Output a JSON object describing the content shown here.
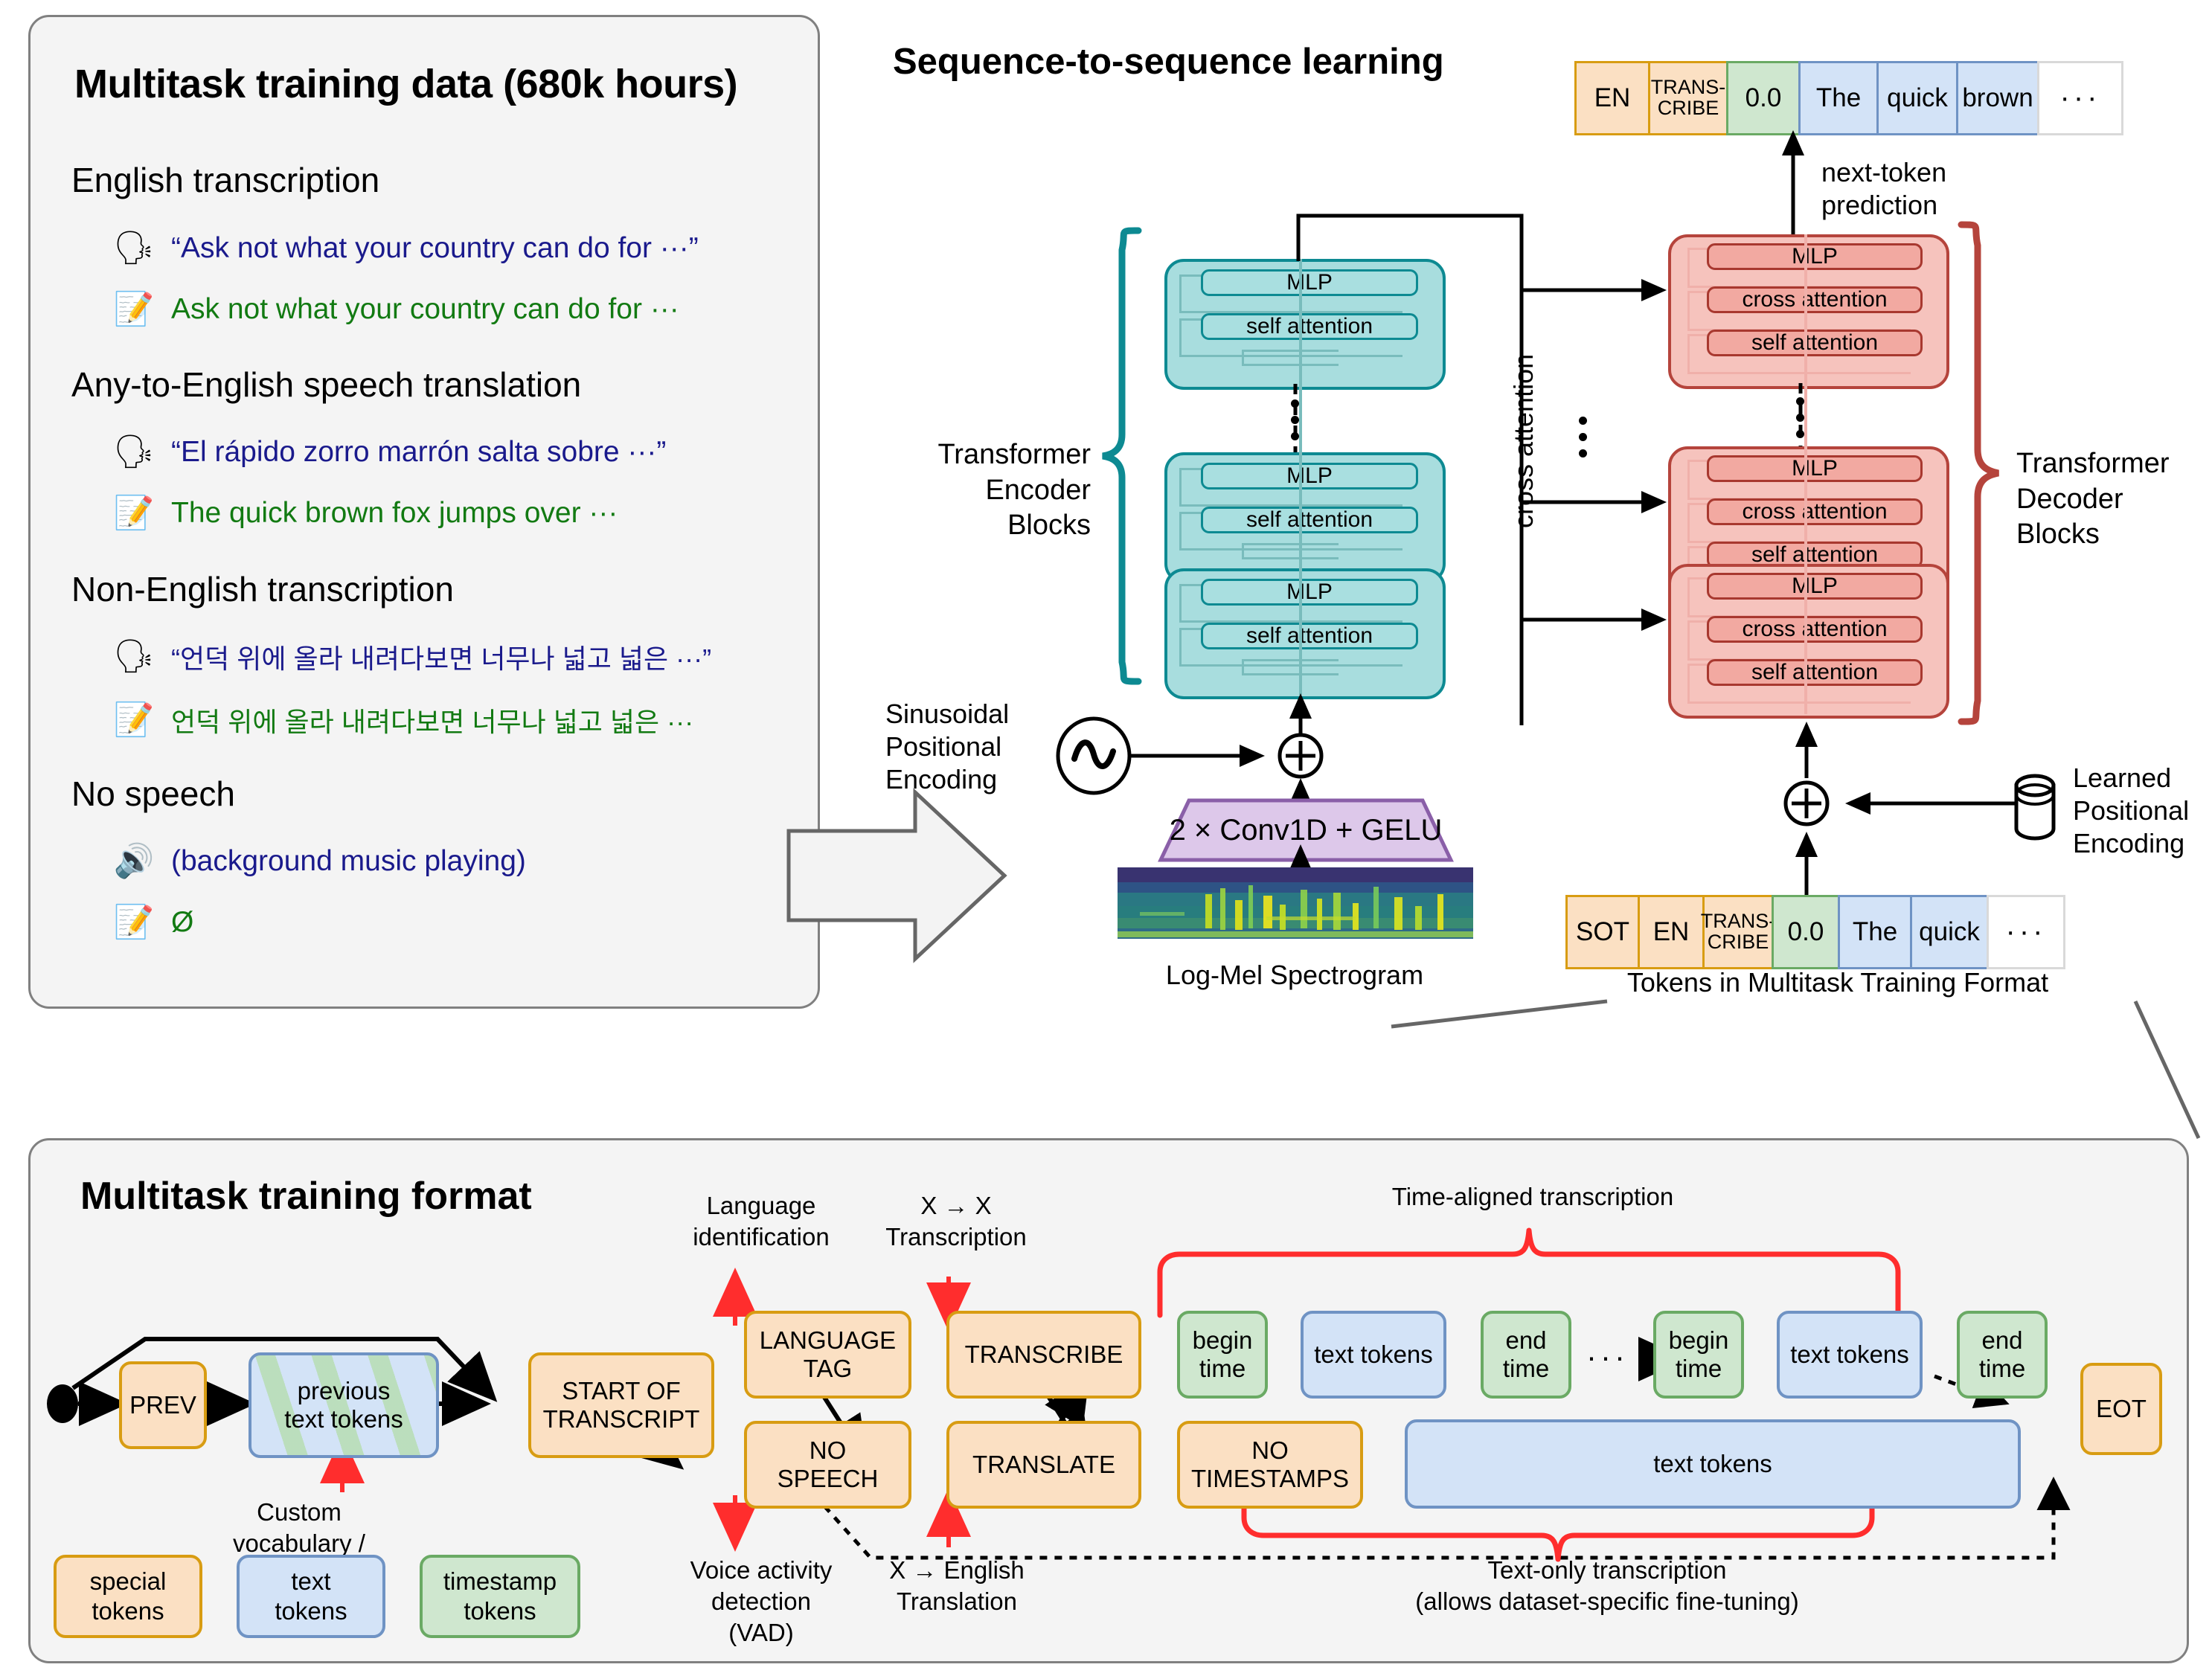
{
  "left_panel": {
    "title": "Multitask training data (680k hours)",
    "categories": [
      {
        "heading": "English transcription",
        "speech_icon": "speaking-head-icon",
        "speech": "“Ask not what your country can do for ···”",
        "text_icon": "memo-pencil-icon",
        "text": "Ask not what your country can do for ···"
      },
      {
        "heading": "Any-to-English speech translation",
        "speech_icon": "speaking-head-icon",
        "speech": "“El rápido zorro marrón salta sobre ···”",
        "text_icon": "memo-pencil-icon",
        "text": "The quick brown fox jumps over ···"
      },
      {
        "heading": "Non-English transcription",
        "speech_icon": "speaking-head-icon",
        "speech": "“언덕 위에 올라 내려다보면 너무나 넓고 넓은 ···”",
        "text_icon": "memo-pencil-icon",
        "text": "언덕 위에 올라 내려다보면 너무나 넓고 넓은 ···"
      },
      {
        "heading": "No speech",
        "speech_icon": "loud-speaker-icon",
        "speech": "(background music playing)",
        "text_icon": "memo-pencil-icon",
        "text": "Ø"
      }
    ]
  },
  "seq2seq": {
    "title": "Sequence-to-sequence learning",
    "output_tokens": [
      {
        "label": "EN",
        "kind": "special"
      },
      {
        "label": "TRANS-\nCRIBE",
        "kind": "special"
      },
      {
        "label": "0.0",
        "kind": "time"
      },
      {
        "label": "The",
        "kind": "text"
      },
      {
        "label": "quick",
        "kind": "text"
      },
      {
        "label": "brown",
        "kind": "text"
      },
      {
        "label": "···",
        "kind": "blank"
      }
    ],
    "input_tokens": [
      {
        "label": "SOT",
        "kind": "special"
      },
      {
        "label": "EN",
        "kind": "special"
      },
      {
        "label": "TRANS-\nCRIBE",
        "kind": "special"
      },
      {
        "label": "0.0",
        "kind": "time"
      },
      {
        "label": "The",
        "kind": "text"
      },
      {
        "label": "quick",
        "kind": "text"
      },
      {
        "label": "···",
        "kind": "blank"
      }
    ],
    "next_token_prediction": "next-token\nprediction",
    "cross_attention": "cross attention",
    "encoder_label": "Transformer\nEncoder Blocks",
    "decoder_label": "Transformer\nDecoder Blocks",
    "encoder_sublayers": [
      "MLP",
      "self attention"
    ],
    "decoder_sublayers": [
      "MLP",
      "cross attention",
      "self attention"
    ],
    "sinusoidal_pe": "Sinusoidal\nPositional\nEncoding",
    "learned_pe": "Learned\nPositional\nEncoding",
    "conv_block": "2 × Conv1D + GELU",
    "spectrogram_caption": "Log-Mel Spectrogram",
    "tokens_caption": "Tokens in Multitask Training Format",
    "sine_icon": "sine-wave-icon",
    "database_icon": "database-cylinder-icon",
    "plus_icon": "circled-plus-icon"
  },
  "bottom_panel": {
    "title": "Multitask training format",
    "nodes": {
      "prev": "PREV",
      "previous_text_tokens": "previous\ntext tokens",
      "start_of_transcript": "START OF\nTRANSCRIPT",
      "language_tag": "LANGUAGE\nTAG",
      "no_speech": "NO\nSPEECH",
      "transcribe": "TRANSCRIBE",
      "translate": "TRANSLATE",
      "no_timestamps": "NO\nTIMESTAMPS",
      "begin_time_1": "begin\ntime",
      "text_tokens_1": "text tokens",
      "end_time_1": "end\ntime",
      "ellipsis": "···",
      "begin_time_2": "begin\ntime",
      "text_tokens_2": "text tokens",
      "end_time_2": "end\ntime",
      "text_tokens_long": "text tokens",
      "eot": "EOT"
    },
    "annotations": {
      "custom_vocabulary": "Custom vocabulary /\nprompting",
      "language_identification": "Language\nidentification",
      "x_to_x_transcription": "X → X\nTranscription",
      "voice_activity_detection": "Voice activity\ndetection\n(VAD)",
      "x_to_english_translation": "X → English\nTranslation",
      "time_aligned_transcription": "Time-aligned transcription",
      "text_only_transcription": "Text-only transcription\n(allows dataset-specific fine-tuning)"
    },
    "legend": [
      {
        "label": "special\ntokens",
        "kind": "special"
      },
      {
        "label": "text\ntokens",
        "kind": "text"
      },
      {
        "label": "timestamp\ntokens",
        "kind": "time"
      }
    ]
  },
  "colors": {
    "special_fill": "#fbe0c3",
    "special_stroke": "#d89c12",
    "text_fill": "#d3e3f7",
    "text_stroke": "#6f93c4",
    "time_fill": "#cfe7cf",
    "time_stroke": "#6aaa64",
    "encoder_fill": "#a8ddde",
    "encoder_stroke": "#0d8a92",
    "decoder_fill": "#f6c3bd",
    "decoder_stroke": "#b5443c",
    "conv_fill": "#ddc8ea",
    "conv_stroke": "#8a5fa8",
    "accent_red": "#ff2d2d",
    "panel_bg": "#f4f4f4",
    "panel_border": "#808080",
    "speech_text": "#1a1a8c",
    "transcript_text": "#127a12"
  }
}
